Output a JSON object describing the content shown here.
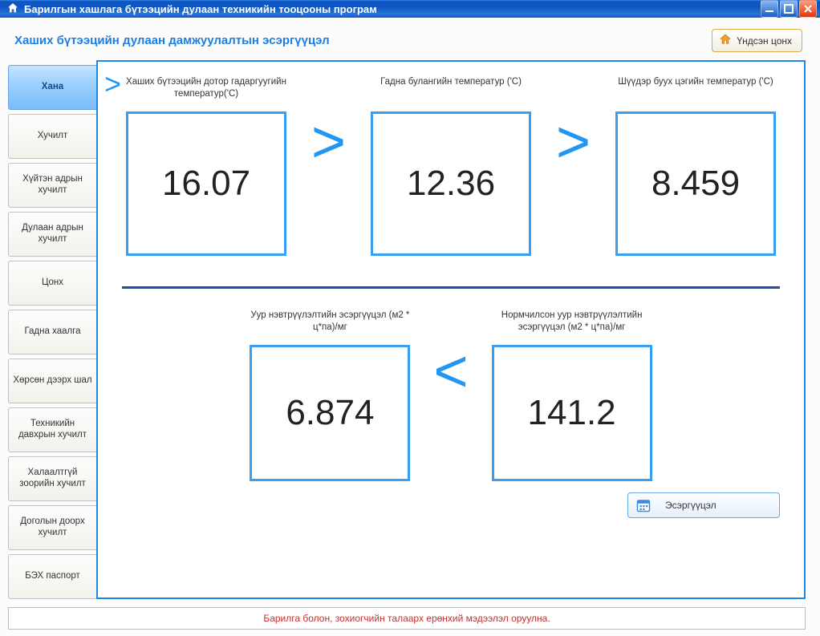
{
  "window": {
    "title": "Барилгын хашлага бүтээцийн дулаан техникийн тооцооны програм"
  },
  "header": {
    "page_title": "Хаших бүтээцийн дулаан дамжуулалтын эсэргүүцэл",
    "home_button": "Үндсэн цонх"
  },
  "sidebar": {
    "items": [
      {
        "label": "Хана",
        "active": true
      },
      {
        "label": "Хучилт",
        "active": false
      },
      {
        "label": "Хүйтэн адрын хучилт",
        "active": false
      },
      {
        "label": "Дулаан адрын хучилт",
        "active": false
      },
      {
        "label": "Цонх",
        "active": false
      },
      {
        "label": "Гадна хаалга",
        "active": false
      },
      {
        "label": "Хөрсөн дээрх шал",
        "active": false
      },
      {
        "label": "Техникийн давхрын хучилт",
        "active": false
      },
      {
        "label": "Халаалтгүй зоорийн хучилт",
        "active": false
      },
      {
        "label": "Доголын доорх хучилт",
        "active": false
      },
      {
        "label": "БЭХ паспорт",
        "active": false
      }
    ]
  },
  "comparators": {
    "gt": ">",
    "lt": "<"
  },
  "top_row": {
    "a": {
      "label": "Хаших бүтээцийн дотор гадаргуугийн температур('C)",
      "value": "16.07"
    },
    "b": {
      "label": "Гадна булангийн температур ('C)",
      "value": "12.36"
    },
    "c": {
      "label": "Шүүдэр буух цэгийн температур ('C)",
      "value": "8.459"
    }
  },
  "bottom_row": {
    "a": {
      "label": "Уур нэвтрүүлэлтийн эсэргүүцэл (м2 * ц*па)/мг",
      "value": "6.874"
    },
    "b": {
      "label": "Нормчилсон уур нэвтрүүлэлтийн эсэргүүцэл (м2 * ц*па)/мг",
      "value": "141.2"
    }
  },
  "action_button": "Эсэргүүцэл",
  "status": "Барилга болон, зохиогчийн талаарх ерөнхий  мэдээлэл оруулна."
}
